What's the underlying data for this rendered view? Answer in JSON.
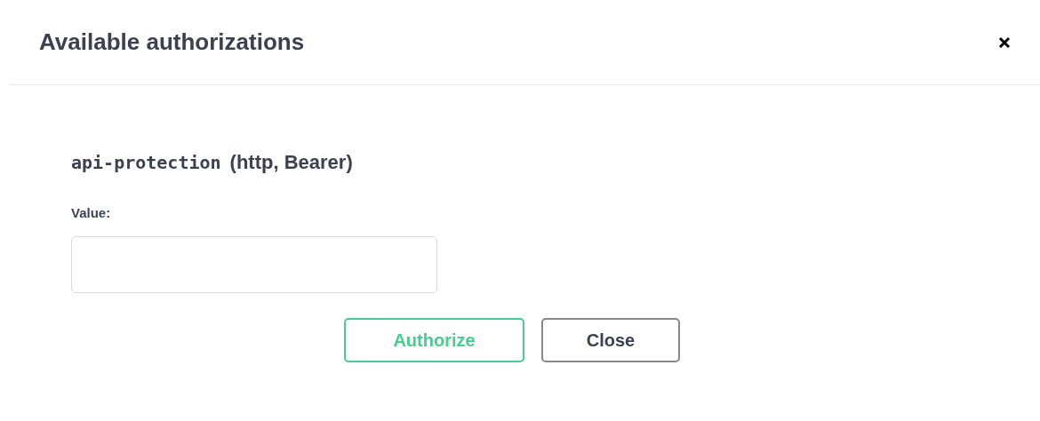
{
  "dialog": {
    "title": "Available authorizations"
  },
  "scheme": {
    "name": "api-protection",
    "type": "(http, Bearer)",
    "field_label": "Value:"
  },
  "buttons": [
    {
      "label": "Authorize",
      "kind": "primary"
    },
    {
      "label": "Close",
      "kind": "secondary"
    }
  ]
}
